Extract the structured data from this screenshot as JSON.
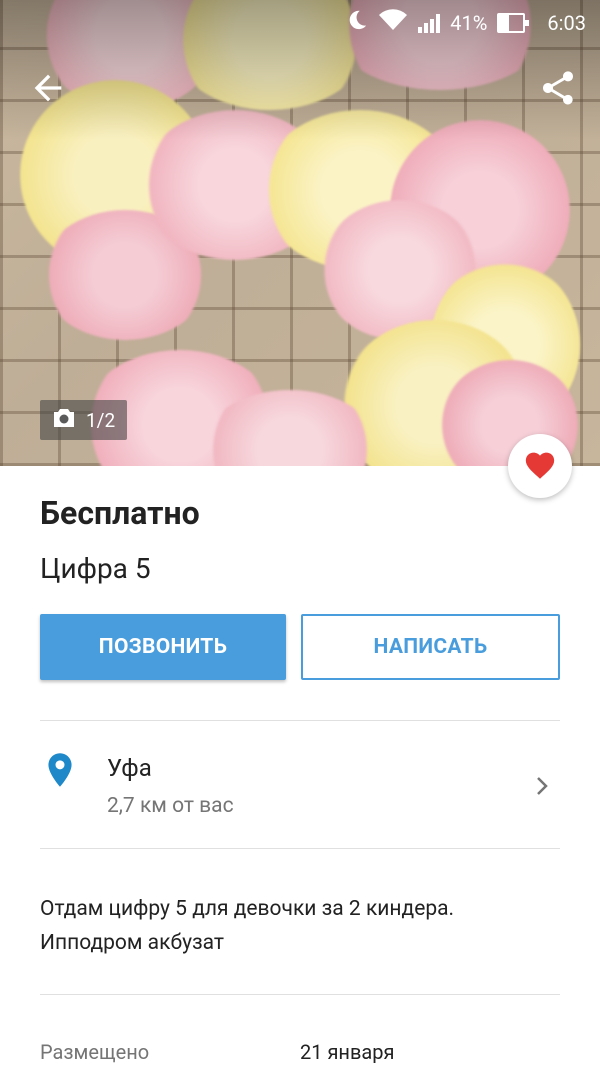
{
  "status_bar": {
    "battery_percent": "41%",
    "time": "6:03",
    "battery_level": 0.41
  },
  "gallery": {
    "counter": "1/2"
  },
  "listing": {
    "price": "Бесплатно",
    "title": "Цифра 5"
  },
  "actions": {
    "call_label": "ПОЗВОНИТЬ",
    "write_label": "НАПИСАТЬ"
  },
  "location": {
    "city": "Уфа",
    "distance": "2,7 км от вас"
  },
  "description": {
    "line1": "Отдам цифру 5 для девочки за 2 киндера.",
    "line2": "Ипподром акбузат"
  },
  "details": {
    "posted_label": "Размещено",
    "posted_value": "21 января"
  },
  "colors": {
    "accent": "#4a9ddc",
    "favorite": "#e53935",
    "pin": "#1e88c8"
  },
  "icons": [
    "back-arrow-icon",
    "share-icon",
    "camera-icon",
    "heart-icon",
    "location-pin-icon",
    "chevron-right-icon",
    "moon-icon",
    "wifi-icon",
    "signal-icon",
    "battery-icon"
  ]
}
